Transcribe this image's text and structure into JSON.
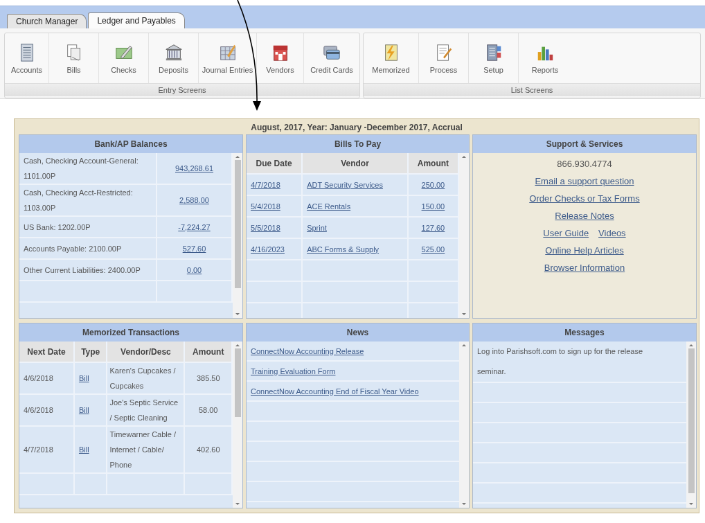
{
  "tabs": [
    {
      "label": "Church Manager",
      "selected": false
    },
    {
      "label": "Ledger and Payables",
      "selected": true
    }
  ],
  "toolbar_groups": [
    {
      "label": "Entry Screens",
      "buttons": [
        "Accounts",
        "Bills",
        "Checks",
        "Deposits",
        "Journal Entries",
        "Vendors",
        "Credit Cards"
      ]
    },
    {
      "label": "List Screens",
      "buttons": [
        "Memorized",
        "Process",
        "Setup",
        "Reports"
      ]
    }
  ],
  "dashboard": {
    "period": "August, 2017, Year: January -December 2017, Accrual",
    "bank_ap_balances": {
      "title": "Bank/AP Balances",
      "rows": [
        {
          "account": "Cash, Checking Account-General: 1101.00P",
          "amount": "943,268.61"
        },
        {
          "account": "Cash, Checking Acct-Restricted: 1103.00P",
          "amount": "2,588.00"
        },
        {
          "account": "US Bank: 1202.00P",
          "amount": "-7,224.27"
        },
        {
          "account": "Accounts Payable: 2100.00P",
          "amount": "527.60"
        },
        {
          "account": "Other Current Liabilities: 2400.00P",
          "amount": "0.00"
        }
      ]
    },
    "bills_to_pay": {
      "title": "Bills To Pay",
      "columns": [
        "Due Date",
        "Vendor",
        "Amount"
      ],
      "rows": [
        [
          "4/7/2018",
          "ADT Security Services",
          "250.00"
        ],
        [
          "5/4/2018",
          "ACE Rentals",
          "150.00"
        ],
        [
          "5/5/2018",
          "Sprint",
          "127.60"
        ],
        [
          "4/16/2023",
          "ABC Forms & Supply",
          "525.00"
        ]
      ]
    },
    "support_services": {
      "title": "Support & Services",
      "phone": "866.930.4774",
      "links": [
        [
          "Email a support question"
        ],
        [
          "Order Checks or Tax Forms"
        ],
        [
          "Release Notes"
        ],
        [
          "User Guide",
          "Videos"
        ],
        [
          "Online Help Articles"
        ],
        [
          "Browser Information"
        ]
      ]
    },
    "memorized_transactions": {
      "title": "Memorized Transactions",
      "columns": [
        "Next Date",
        "Type",
        "Vendor/Desc",
        "Amount"
      ],
      "rows": [
        [
          "4/6/2018",
          "Bill",
          "Karen's Cupcakes / Cupcakes",
          "385.50"
        ],
        [
          "4/6/2018",
          "Bill",
          "Joe's Septic Service / Septic Cleaning",
          "58.00"
        ],
        [
          "4/7/2018",
          "Bill",
          "Timewarner Cable / Internet / Cable/ Phone",
          "402.60"
        ]
      ]
    },
    "news": {
      "title": "News",
      "items": [
        "ConnectNow Accounting Release",
        "Training Evaluation Form",
        "ConnectNow Accounting End of Fiscal Year Video"
      ]
    },
    "messages": {
      "title": "Messages",
      "items": [
        "Log into Parishsoft.com to sign up for the release seminar."
      ]
    }
  }
}
